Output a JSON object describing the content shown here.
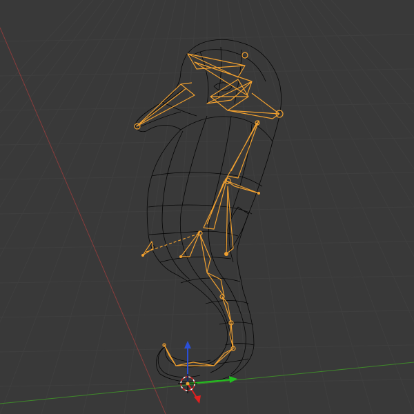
{
  "viewport": {
    "background": "#393939",
    "grid_color": "#3f3f3f"
  },
  "axes": {
    "x_color": "#8a3c3c",
    "y_color": "#3f8a2a"
  },
  "model": {
    "wireframe_color": "#050505",
    "armature_color": "#f0a030",
    "display_mode": "wireframe",
    "bone_shape": "octahedral"
  },
  "gizmo": {
    "z_arrow_color": "#2a4fd8",
    "y_arrow_color": "#22c020",
    "x_arrow_color": "#e02020",
    "cursor_colors": [
      "#ffffff",
      "#d02020"
    ]
  }
}
